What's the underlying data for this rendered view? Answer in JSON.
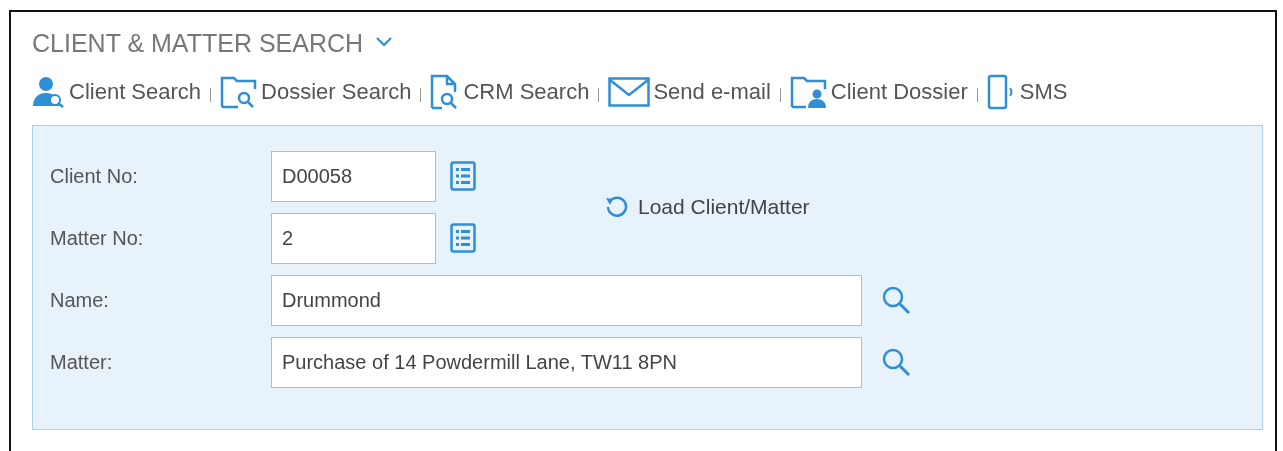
{
  "panel": {
    "title": "CLIENT & MATTER SEARCH",
    "expanded": true
  },
  "toolbar": [
    {
      "label": "Client Search",
      "kind": "client"
    },
    {
      "label": "Dossier Search",
      "kind": "dossier"
    },
    {
      "label": "CRM Search",
      "kind": "crm"
    },
    {
      "label": "Send e-mail",
      "kind": "email"
    },
    {
      "label": "Client Dossier",
      "kind": "client-dossier"
    },
    {
      "label": "SMS",
      "kind": "sms"
    }
  ],
  "fields": [
    {
      "label": "Client No:",
      "value": "D00058",
      "kind": "lookup"
    },
    {
      "label": "Matter No:",
      "value": "2",
      "kind": "lookup"
    },
    {
      "label": "Name:",
      "value": "Drummond",
      "kind": "search"
    },
    {
      "label": "Matter:",
      "value": "Purchase of 14 Powdermill Lane, TW11 8PN",
      "kind": "search"
    }
  ],
  "load_button": {
    "label": "Load Client/Matter"
  }
}
